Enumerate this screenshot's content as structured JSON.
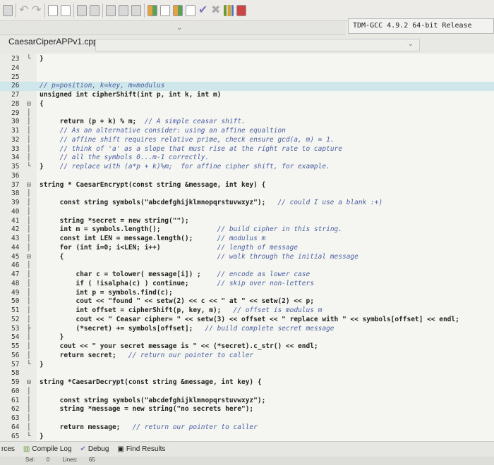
{
  "toolbar": {
    "compiler": "TDM-GCC 4.9.2 64-bit Release"
  },
  "editor": {
    "file_tab": "CaesarCiperAPPv1.cpp"
  },
  "lines": [
    {
      "n": "23",
      "fold": "└",
      "code": "}",
      "comment": ""
    },
    {
      "n": "24",
      "fold": "",
      "code": "",
      "comment": ""
    },
    {
      "n": "25",
      "fold": "",
      "code": "",
      "comment": ""
    },
    {
      "n": "26",
      "fold": "",
      "code": "",
      "comment": "// p=position, k=key, m=modulus"
    },
    {
      "n": "27",
      "fold": "",
      "code": "unsigned int cipherShift(int p, int k, int m)",
      "comment": ""
    },
    {
      "n": "28",
      "fold": "⊟",
      "code": "{",
      "comment": ""
    },
    {
      "n": "29",
      "fold": "│",
      "code": "",
      "comment": ""
    },
    {
      "n": "30",
      "fold": "│",
      "code": "     return (p + k) % m;  ",
      "comment": "// A simple ceasar shift."
    },
    {
      "n": "31",
      "fold": "│",
      "code": "     ",
      "comment": "// As an alternative consider: using an affine equaltion"
    },
    {
      "n": "32",
      "fold": "│",
      "code": "     ",
      "comment": "// affine shift requires relative prime, check ensure gcd(a, m) = 1."
    },
    {
      "n": "33",
      "fold": "│",
      "code": "     ",
      "comment": "// think of 'a' as a slope that must rise at the right rate to capture"
    },
    {
      "n": "34",
      "fold": "│",
      "code": "     ",
      "comment": "// all the symbols 0...m-1 correctly."
    },
    {
      "n": "35",
      "fold": "└",
      "code": "}    ",
      "comment": "// replace with (a*p + k)%m;  for affine cipher shift, for example."
    },
    {
      "n": "36",
      "fold": "",
      "code": "",
      "comment": ""
    },
    {
      "n": "37",
      "fold": "⊟",
      "code": "string * CaesarEncrypt(const string &message, int key) {",
      "comment": ""
    },
    {
      "n": "38",
      "fold": "│",
      "code": "",
      "comment": ""
    },
    {
      "n": "39",
      "fold": "│",
      "code": "     const string symbols(\"abcdefghijklmnopqrstuvwxyz\");   ",
      "comment": "// could I use a blank :+)"
    },
    {
      "n": "40",
      "fold": "│",
      "code": "",
      "comment": ""
    },
    {
      "n": "41",
      "fold": "│",
      "code": "     string *secret = new string(\"\");",
      "comment": ""
    },
    {
      "n": "42",
      "fold": "│",
      "code": "     int m = symbols.length();              ",
      "comment": "// build cipher in this string."
    },
    {
      "n": "43",
      "fold": "│",
      "code": "     const int LEN = message.length();      ",
      "comment": "// modulus m"
    },
    {
      "n": "44",
      "fold": "│",
      "code": "     for (int i=0; i<LEN; i++)              ",
      "comment": "// length of message"
    },
    {
      "n": "45",
      "fold": "⊟",
      "code": "     {                                      ",
      "comment": "// walk through the initial message"
    },
    {
      "n": "46",
      "fold": "│",
      "code": "",
      "comment": ""
    },
    {
      "n": "47",
      "fold": "│",
      "code": "         char c = tolower( message[i]) ;    ",
      "comment": "// encode as lower case"
    },
    {
      "n": "48",
      "fold": "│",
      "code": "         if ( !isalpha(c) ) continue;       ",
      "comment": "// skip over non-letters"
    },
    {
      "n": "49",
      "fold": "│",
      "code": "         int p = symbols.find(c);",
      "comment": ""
    },
    {
      "n": "50",
      "fold": "│",
      "code": "         cout << \"found \" << setw(2) << c << \" at \" << setw(2) << p;",
      "comment": ""
    },
    {
      "n": "51",
      "fold": "│",
      "code": "         int offset = cipherShift(p, key, m);   ",
      "comment": "// offset is modulus m"
    },
    {
      "n": "52",
      "fold": "│",
      "code": "         cout << \" Ceasar cipher= \" << setw(3) << offset << \" replace with \" << symbols[offset] << endl;",
      "comment": ""
    },
    {
      "n": "53",
      "fold": "├",
      "code": "         (*secret) += symbols[offset];   ",
      "comment": "// build complete secret message"
    },
    {
      "n": "54",
      "fold": "│",
      "code": "     }",
      "comment": ""
    },
    {
      "n": "55",
      "fold": "│",
      "code": "     cout << \" your secret message is \" << (*secret).c_str() << endl;",
      "comment": ""
    },
    {
      "n": "56",
      "fold": "│",
      "code": "     return secret;   ",
      "comment": "// return our pointer to caller"
    },
    {
      "n": "57",
      "fold": "└",
      "code": "}",
      "comment": ""
    },
    {
      "n": "58",
      "fold": "",
      "code": "",
      "comment": ""
    },
    {
      "n": "59",
      "fold": "⊟",
      "code": "string *CaesarDecrypt(const string &message, int key) {",
      "comment": ""
    },
    {
      "n": "60",
      "fold": "│",
      "code": "",
      "comment": ""
    },
    {
      "n": "61",
      "fold": "│",
      "code": "     const string symbols(\"abcdefghijklmnopqrstuvwxyz\");",
      "comment": ""
    },
    {
      "n": "62",
      "fold": "│",
      "code": "     string *message = new string(\"no secrets here\");",
      "comment": ""
    },
    {
      "n": "63",
      "fold": "│",
      "code": "",
      "comment": ""
    },
    {
      "n": "64",
      "fold": "│",
      "code": "     return message;   ",
      "comment": "// return our pointer to caller"
    },
    {
      "n": "65",
      "fold": "└",
      "code": "}",
      "comment": ""
    }
  ],
  "bottom_tabs": {
    "resources": "rces",
    "compile_log": "Compile Log",
    "debug": "Debug",
    "find_results": "Find Results"
  },
  "status": {
    "sel_label": "Sel:",
    "sel_value": "0",
    "lines_label": "Lines:",
    "lines_value": "65"
  }
}
